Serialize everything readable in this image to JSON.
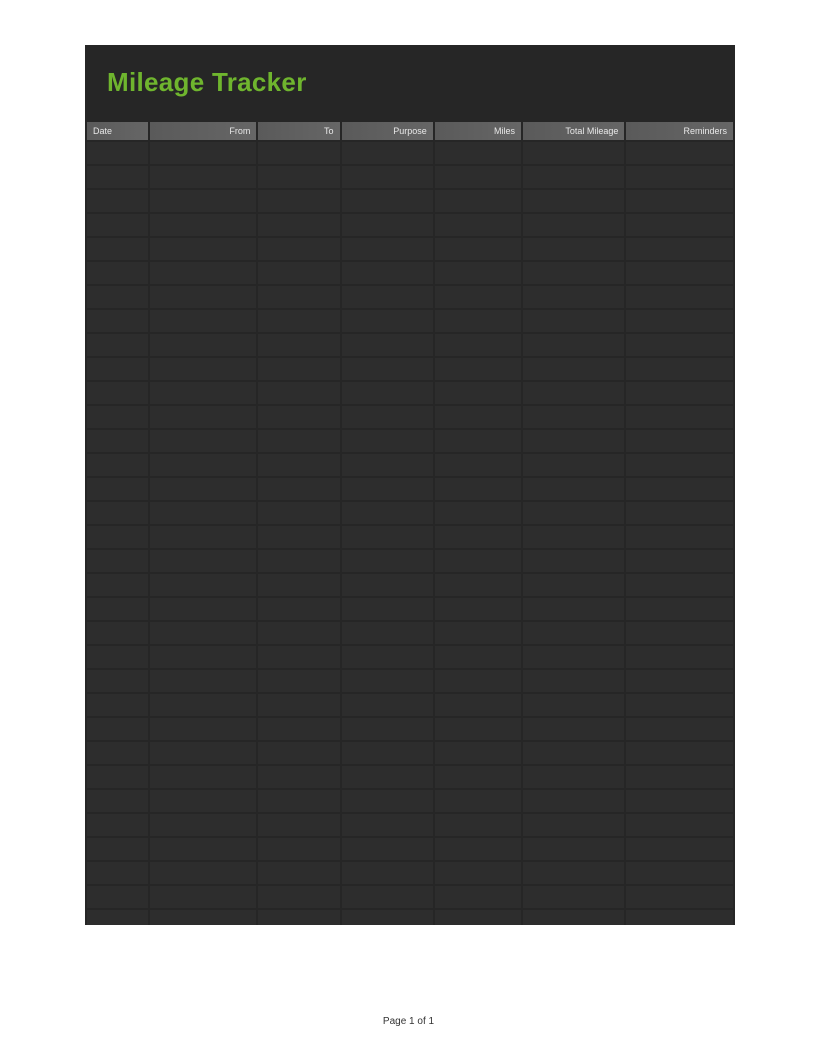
{
  "title": "Mileage Tracker",
  "columns": [
    "Date",
    "From",
    "To",
    "Purpose",
    "Miles",
    "Total Mileage",
    "Reminders"
  ],
  "row_count": 34,
  "footer": "Page 1 of 1"
}
